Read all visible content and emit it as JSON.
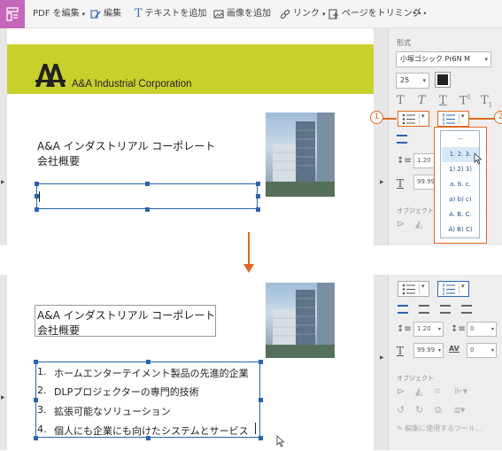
{
  "toolbar": {
    "edit_pdf": "PDF を編集",
    "edit": "編集",
    "add_text": "テキストを追加",
    "add_image": "画像を追加",
    "link": "リンク",
    "crop_page": "ページをトリミング",
    "more": "•••"
  },
  "document": {
    "company_mark": "A&A",
    "company_name": "A&A Industrial Corporation",
    "title_line1": "A&A インダストリアル コーポレート",
    "title_line2": "会社概要",
    "list_items": [
      "ホームエンターテイメント製品の先進的企業",
      "DLPプロジェクターの専門的技術",
      "拡張可能なソリューション",
      "個人にも企業にも向けたシステムとサービス"
    ],
    "list_numbers": [
      "1.",
      "2.",
      "3.",
      "4."
    ]
  },
  "panel": {
    "format_label": "形式",
    "font_name": "小塚ゴシック Pr6N M",
    "font_size": "25",
    "line_spacing": "1.20",
    "scale": "99.99",
    "para_spacing": "0",
    "char_spacing": "0",
    "object_label": "オブジェクト",
    "edit_with": "編集に使用するツール...",
    "numbering_options": [
      "--",
      "1. 2. 3.",
      "1) 2) 3)",
      "a. b. c.",
      "a) b) c)",
      "A. B. C.",
      "A) B) C)"
    ],
    "annotation_1": "1",
    "annotation_2": "2"
  },
  "colors": {
    "banner": "#c8d12c",
    "accent_orange": "#e06a1e",
    "selection_blue": "#2a63b5",
    "app_icon": "#c566b8"
  }
}
